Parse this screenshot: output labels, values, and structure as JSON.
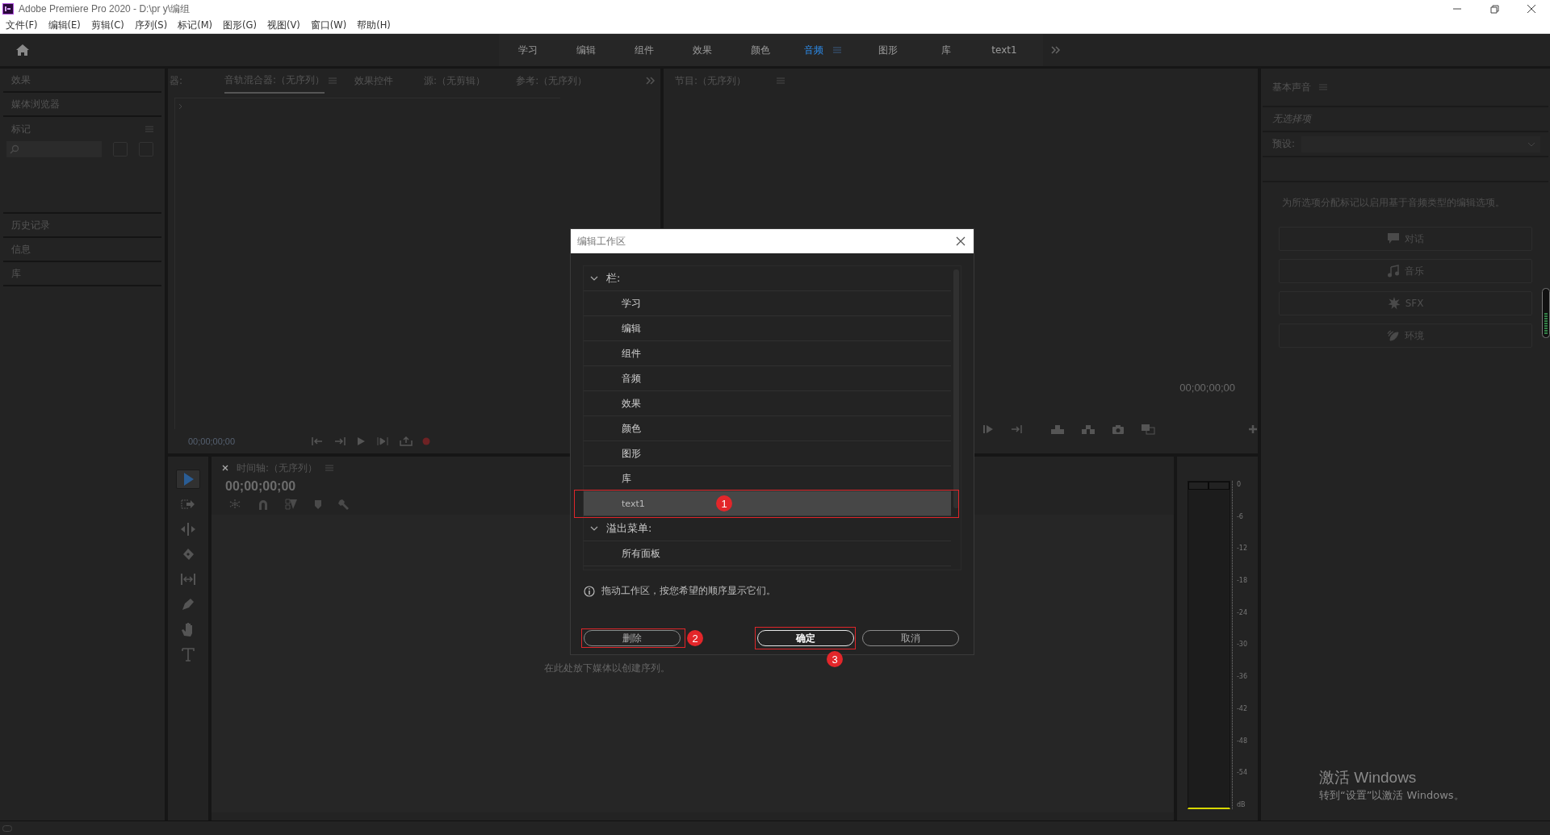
{
  "window": {
    "title": "Adobe Premiere Pro 2020 - D:\\pr y\\编组"
  },
  "menu": [
    "文件(F)",
    "编辑(E)",
    "剪辑(C)",
    "序列(S)",
    "标记(M)",
    "图形(G)",
    "视图(V)",
    "窗口(W)",
    "帮助(H)"
  ],
  "workspaces": [
    {
      "label": "学习",
      "selected": false
    },
    {
      "label": "编辑",
      "selected": false
    },
    {
      "label": "组件",
      "selected": false
    },
    {
      "label": "效果",
      "selected": false
    },
    {
      "label": "颜色",
      "selected": false
    },
    {
      "label": "音频",
      "selected": true
    },
    {
      "label": "图形",
      "selected": false
    },
    {
      "label": "库",
      "selected": false
    },
    {
      "label": "text1",
      "selected": false
    }
  ],
  "left_panels_top": [
    "效果",
    "媒体浏览器"
  ],
  "markers_panel": {
    "title": "标记"
  },
  "left_panels_bottom": [
    "历史记录",
    "信息",
    "库"
  ],
  "source_panel": {
    "tabs": [
      {
        "label": "器:",
        "selected": false
      },
      {
        "label": "音轨混合器:（无序列）",
        "selected": true
      },
      {
        "label": "效果控件",
        "selected": false
      },
      {
        "label": "源:（无剪辑）",
        "selected": false
      },
      {
        "label": "参考:（无序列）",
        "selected": false
      }
    ],
    "timecode": "00;00;00;00"
  },
  "program_panel": {
    "title": "节目:（无序列）",
    "timecode": "00;00;00;00"
  },
  "tools": [
    {
      "kind": "selection",
      "selected": true
    },
    {
      "kind": "track-select",
      "selected": false
    },
    {
      "kind": "ripple",
      "selected": false
    },
    {
      "kind": "razor",
      "selected": false
    },
    {
      "kind": "slip",
      "selected": false
    },
    {
      "kind": "pen",
      "selected": false
    },
    {
      "kind": "hand",
      "selected": false
    },
    {
      "kind": "type",
      "selected": false
    }
  ],
  "timeline": {
    "title": "时间轴:（无序列）",
    "timecode": "00;00;00;00",
    "hint": "在此处放下媒体以创建序列。"
  },
  "meter": {
    "ticks": [
      "0",
      "-6",
      "-12",
      "-18",
      "-24",
      "-30",
      "-36",
      "-42",
      "-48",
      "-54",
      "dB"
    ]
  },
  "essential_sound": {
    "title": "基本声音",
    "status": "无选择项",
    "preset_label": "预设:",
    "description": "为所选项分配标记以启用基于音频类型的编辑选项。",
    "buttons": [
      {
        "label": "对话",
        "kind": "dialogue"
      },
      {
        "label": "音乐",
        "kind": "music"
      },
      {
        "label": "SFX",
        "kind": "sfx"
      },
      {
        "label": "环境",
        "kind": "ambience"
      }
    ]
  },
  "os_notice": {
    "title": "激活 Windows",
    "text": "转到“设置”以激活 Windows。"
  },
  "dialog": {
    "title": "编辑工作区",
    "groups": [
      {
        "label": "栏:",
        "expanded": true,
        "children": [
          {
            "label": "学习",
            "selected": false
          },
          {
            "label": "编辑",
            "selected": false
          },
          {
            "label": "组件",
            "selected": false
          },
          {
            "label": "音频",
            "selected": false
          },
          {
            "label": "效果",
            "selected": false
          },
          {
            "label": "颜色",
            "selected": false
          },
          {
            "label": "图形",
            "selected": false
          },
          {
            "label": "库",
            "selected": false
          },
          {
            "label": "text1",
            "selected": true,
            "annotation": "1"
          }
        ]
      },
      {
        "label": "溢出菜单:",
        "expanded": true,
        "children": [
          {
            "label": "所有面板",
            "selected": false
          }
        ]
      }
    ],
    "info": "拖动工作区，按您希望的顺序显示它们。",
    "buttons": [
      {
        "label": "删除",
        "kind": "secondary",
        "annotation": "2"
      },
      {
        "label": "确定",
        "kind": "primary",
        "annotation": "3"
      },
      {
        "label": "取消",
        "kind": "secondary"
      }
    ]
  }
}
